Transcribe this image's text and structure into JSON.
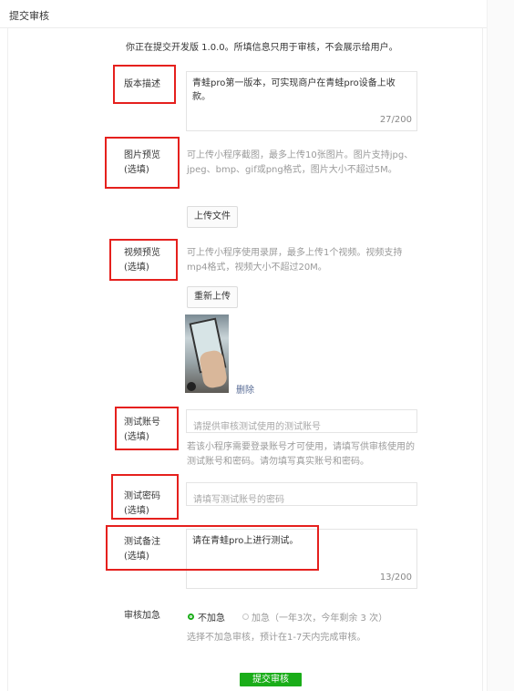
{
  "header": {
    "title": "提交审核"
  },
  "intro": "你正在提交开发版 1.0.0。所填信息只用于审核，不会展示给用户。",
  "version_desc": {
    "label": "版本描述",
    "value": "青蛙pro第一版本，可实现商户在青蛙pro设备上收款。",
    "counter": "27/200"
  },
  "image_preview": {
    "label_1": "图片预览",
    "label_2": "(选填)",
    "hint": "可上传小程序截图，最多上传10张图片。图片支持jpg、jpeg、bmp、gif或png格式，图片大小不超过5M。",
    "button": "上传文件"
  },
  "video_preview": {
    "label_1": "视频预览",
    "label_2": "(选填)",
    "hint": "可上传小程序使用录屏，最多上传1个视频。视频支持mp4格式，视频大小不超过20M。",
    "button": "重新上传",
    "delete": "删除"
  },
  "test_account": {
    "label_1": "测试账号",
    "label_2": "(选填)",
    "placeholder": "请提供审核测试使用的测试账号",
    "hint": "若该小程序需要登录账号才可使用，请填写供审核使用的测试账号和密码。请勿填写真实账号和密码。"
  },
  "test_password": {
    "label_1": "测试密码",
    "label_2": "(选填)",
    "placeholder": "请填写测试账号的密码"
  },
  "test_notes": {
    "label_1": "测试备注",
    "label_2": "(选填)",
    "value": "请在青蛙pro上进行测试。",
    "counter": "13/200"
  },
  "expedite": {
    "label": "审核加急",
    "option_no": "不加急",
    "option_yes": "加急（一年3次，今年剩余 3 次）",
    "hint": "选择不加急审核，预计在1-7天内完成审核。"
  },
  "submit_label": "提交审核",
  "colors": {
    "accent": "#1aad19",
    "highlight": "#e5201d",
    "link": "#576b95"
  }
}
